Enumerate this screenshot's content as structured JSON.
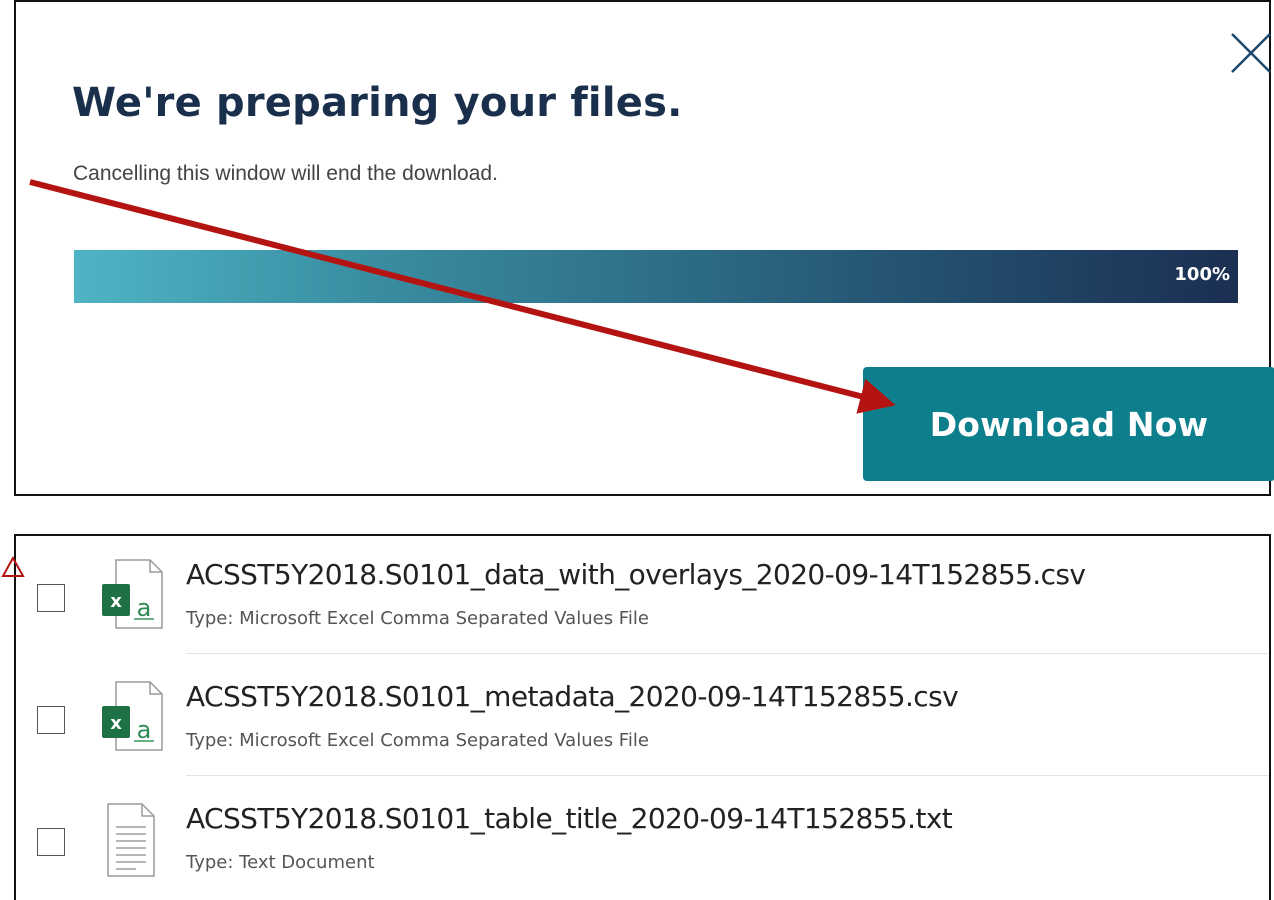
{
  "dialog": {
    "title": "We're preparing your files.",
    "subtitle": "Cancelling this window will end the download.",
    "progress": {
      "percent": 100,
      "label": "100%",
      "color_start": "#4fb4c4",
      "color_end": "#1b2f52"
    },
    "download_button_label": "Download Now",
    "download_button_color": "#0d7f8c",
    "close_icon": "close-icon"
  },
  "annotation": {
    "arrow_color": "#b31412"
  },
  "files": [
    {
      "name": "ACSST5Y2018.S0101_data_with_overlays_2020-09-14T152855.csv",
      "type_label": "Type:",
      "type_value": "Microsoft Excel Comma Separated Values File",
      "icon": "excel-csv-icon"
    },
    {
      "name": "ACSST5Y2018.S0101_metadata_2020-09-14T152855.csv",
      "type_label": "Type:",
      "type_value": "Microsoft Excel Comma Separated Values File",
      "icon": "excel-csv-icon"
    },
    {
      "name": "ACSST5Y2018.S0101_table_title_2020-09-14T152855.txt",
      "type_label": "Type:",
      "type_value": "Text Document",
      "icon": "text-document-icon"
    }
  ]
}
